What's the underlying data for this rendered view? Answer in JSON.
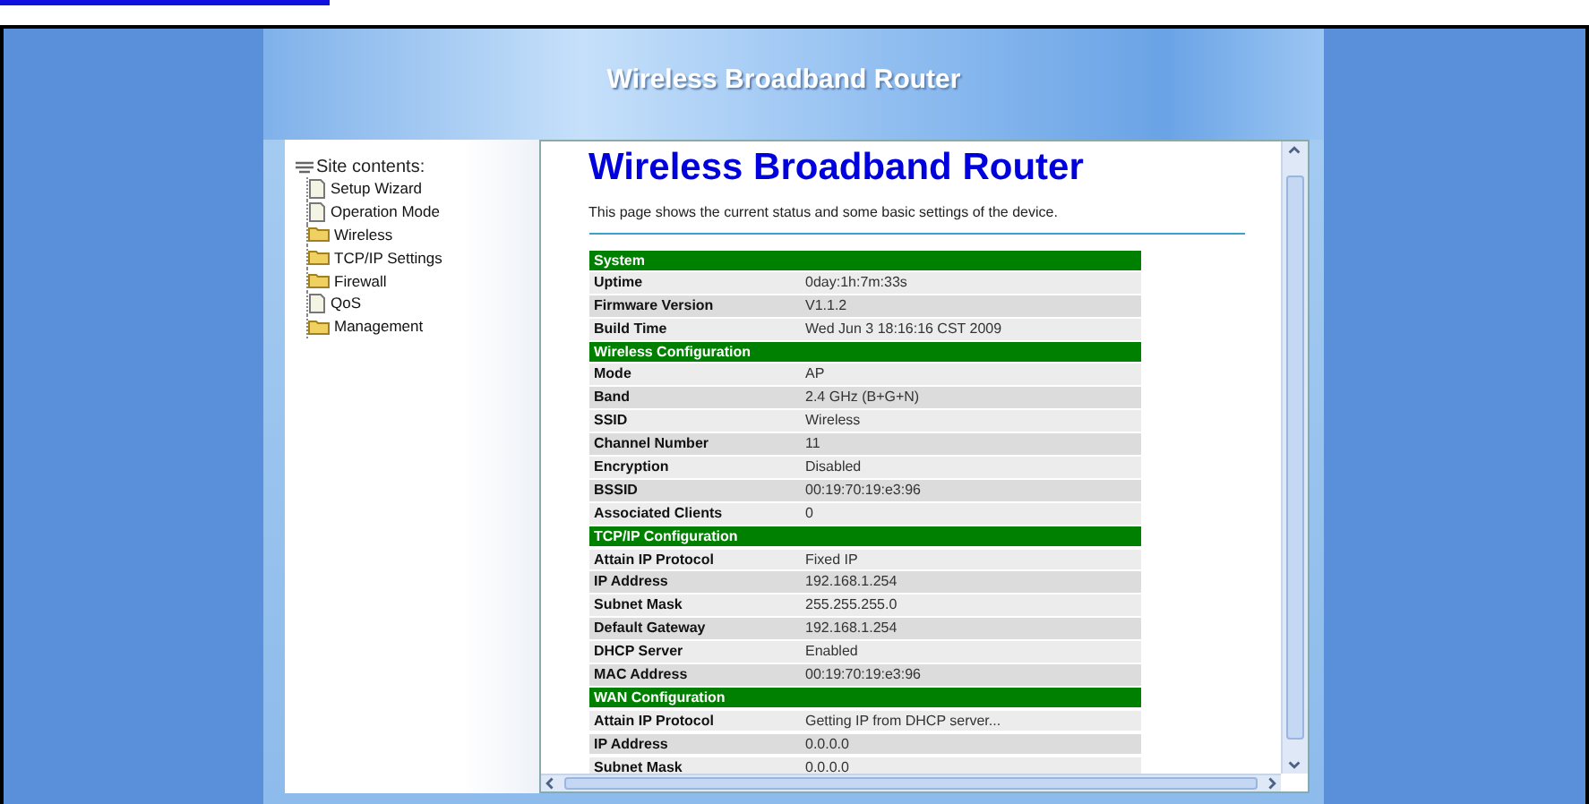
{
  "banner": {
    "title": "Wireless Broadband Router"
  },
  "sidebar": {
    "heading": "Site contents:",
    "items": [
      {
        "label": "Setup Wizard",
        "kind": "page"
      },
      {
        "label": "Operation Mode",
        "kind": "page"
      },
      {
        "label": "Wireless",
        "kind": "folder"
      },
      {
        "label": "TCP/IP Settings",
        "kind": "folder"
      },
      {
        "label": "Firewall",
        "kind": "folder"
      },
      {
        "label": "QoS",
        "kind": "page"
      },
      {
        "label": "Management",
        "kind": "folder"
      }
    ]
  },
  "content": {
    "title": "Wireless Broadband Router",
    "description": "This page shows the current status and some basic settings of the device.",
    "sections": [
      {
        "title": "System",
        "rows": [
          [
            "Uptime",
            "0day:1h:7m:33s"
          ],
          [
            "Firmware Version",
            "V1.1.2"
          ],
          [
            "Build Time",
            "Wed Jun 3 18:16:16 CST 2009"
          ]
        ]
      },
      {
        "title": "Wireless Configuration",
        "rows": [
          [
            "Mode",
            "AP"
          ],
          [
            "Band",
            "2.4 GHz (B+G+N)"
          ],
          [
            "SSID",
            "Wireless"
          ],
          [
            "Channel Number",
            "11"
          ],
          [
            "Encryption",
            "Disabled"
          ],
          [
            "BSSID",
            "00:19:70:19:e3:96"
          ],
          [
            "Associated Clients",
            "0"
          ]
        ]
      },
      {
        "title": "TCP/IP Configuration",
        "rows": [
          [
            "Attain IP Protocol",
            "Fixed IP"
          ],
          [
            "IP Address",
            "192.168.1.254"
          ],
          [
            "Subnet Mask",
            "255.255.255.0"
          ],
          [
            "Default Gateway",
            "192.168.1.254"
          ],
          [
            "DHCP Server",
            "Enabled"
          ],
          [
            "MAC Address",
            "00:19:70:19:e3:96"
          ]
        ]
      },
      {
        "title": "WAN Configuration",
        "rows": [
          [
            "Attain IP Protocol",
            "Getting IP from DHCP server..."
          ],
          [
            "IP Address",
            "0.0.0.0"
          ],
          [
            "Subnet Mask",
            "0.0.0.0"
          ]
        ]
      }
    ]
  }
}
